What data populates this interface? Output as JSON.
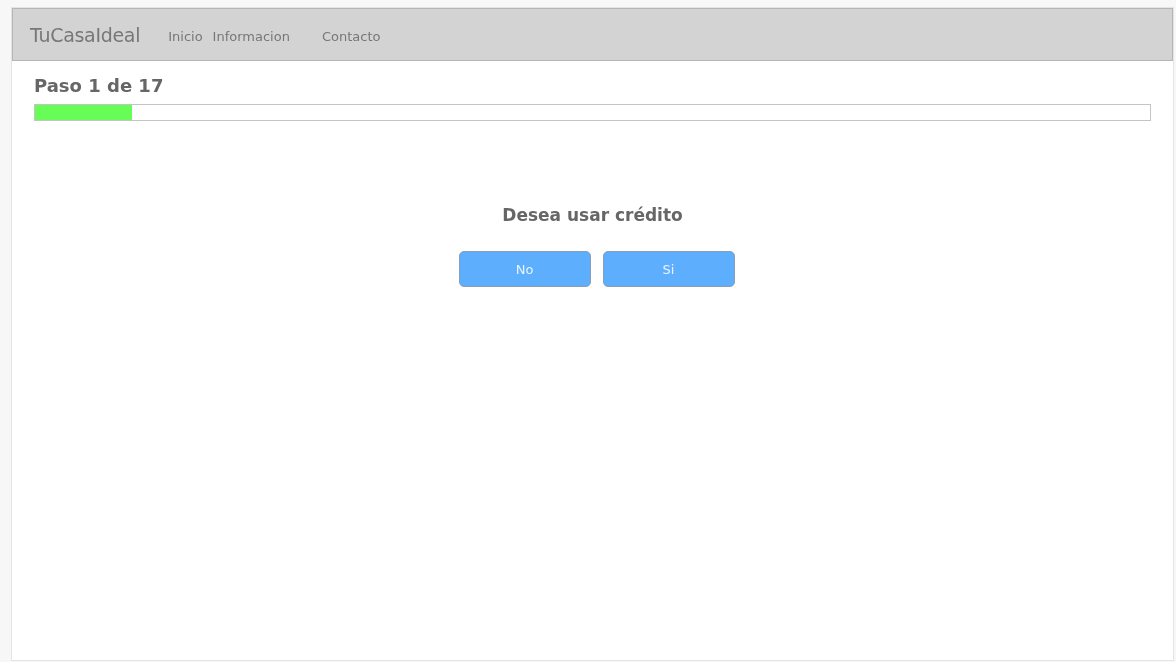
{
  "navbar": {
    "brand": "TuCasaIdeal",
    "links": [
      {
        "label": "Inicio"
      },
      {
        "label": "Informacion"
      },
      {
        "label": "Contacto"
      }
    ]
  },
  "step": {
    "label": "Paso 1 de 17",
    "level": 0.087
  },
  "question": "Desea usar crédito",
  "answers": [
    {
      "label": "No"
    },
    {
      "label": "Si"
    }
  ]
}
